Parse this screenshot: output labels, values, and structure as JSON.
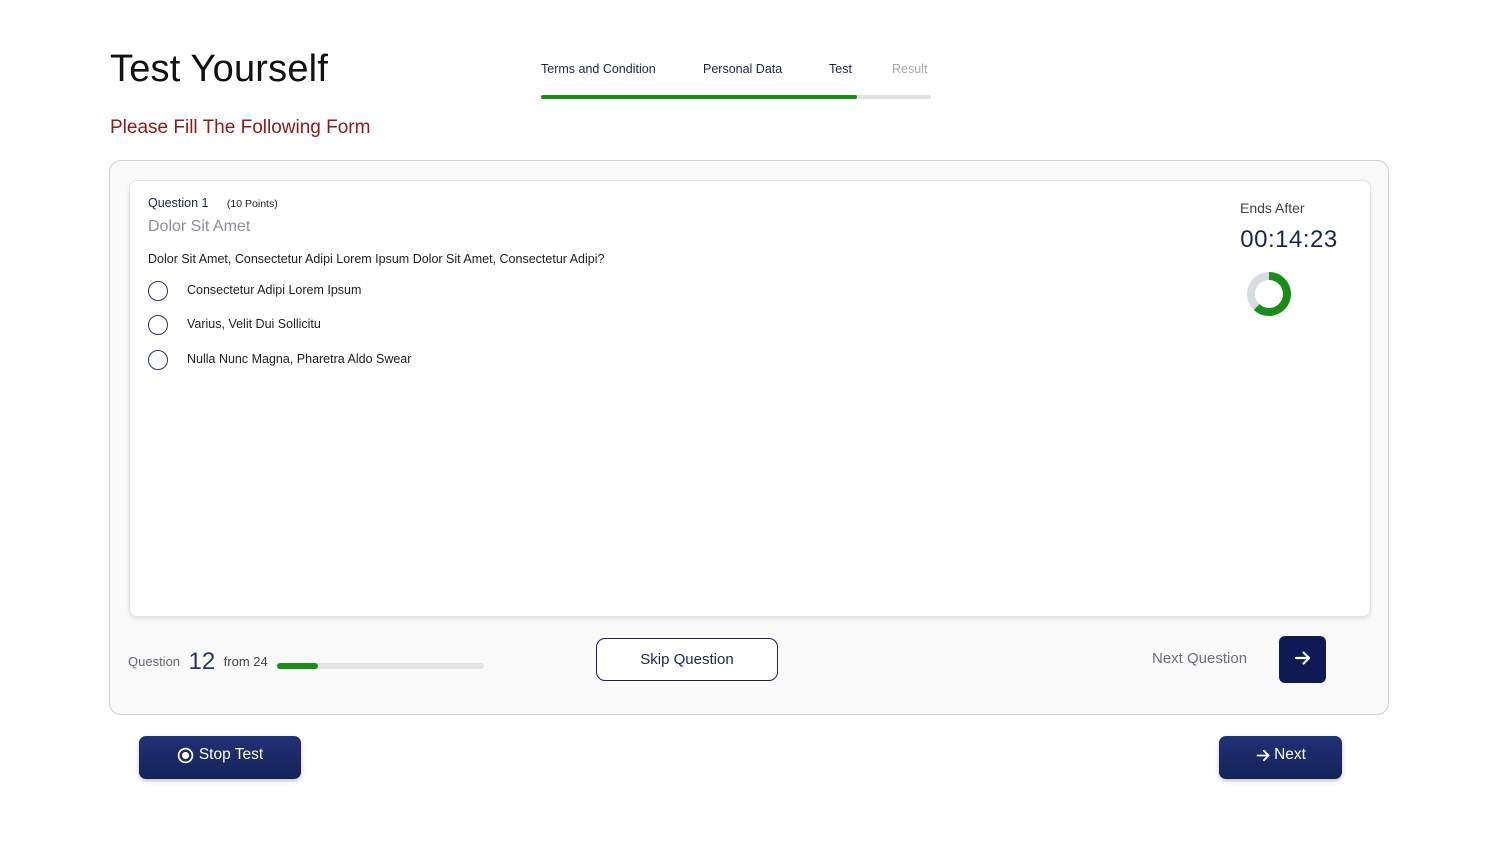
{
  "header": {
    "title": "Test Yourself",
    "subtitle": "Please Fill The Following Form"
  },
  "stepper": {
    "steps": [
      {
        "label": "Terms and Condition",
        "state": "done"
      },
      {
        "label": "Personal Data",
        "state": "done"
      },
      {
        "label": "Test",
        "state": "active"
      },
      {
        "label": "Result",
        "state": "pending"
      }
    ],
    "progress_fraction": 0.81
  },
  "question": {
    "number_label": "Question 1",
    "points_label": "(10 Points)",
    "topic": "Dolor Sit Amet",
    "text": "Dolor Sit Amet, Consectetur Adipi Lorem Ipsum Dolor Sit Amet, Consectetur Adipi?",
    "options": [
      {
        "label": "Consectetur Adipi Lorem Ipsum",
        "selected": false
      },
      {
        "label": "Varius, Velit Dui Sollicitu",
        "selected": false
      },
      {
        "label": "Nulla Nunc Magna, Pharetra Aldo Swear",
        "selected": false
      }
    ]
  },
  "timer": {
    "label": "Ends After",
    "value": "00:14:23",
    "remaining_fraction": 0.62
  },
  "progress": {
    "label": "Question",
    "current": "12",
    "total_label": "from 24",
    "fraction": 0.2
  },
  "actions": {
    "skip_label": "Skip Question",
    "next_question_label": "Next Question",
    "stop_label": "Stop Test",
    "next_label": "Next"
  },
  "icons": {
    "next_question": "arrow-right-icon",
    "stop": "stop-circle-icon",
    "next": "arrow-right-icon"
  },
  "colors": {
    "primary": "#0f1a55",
    "accent_green": "#1a8c1a",
    "subtitle_red": "#8b1a1a",
    "ring_track": "#d9dbe3"
  }
}
